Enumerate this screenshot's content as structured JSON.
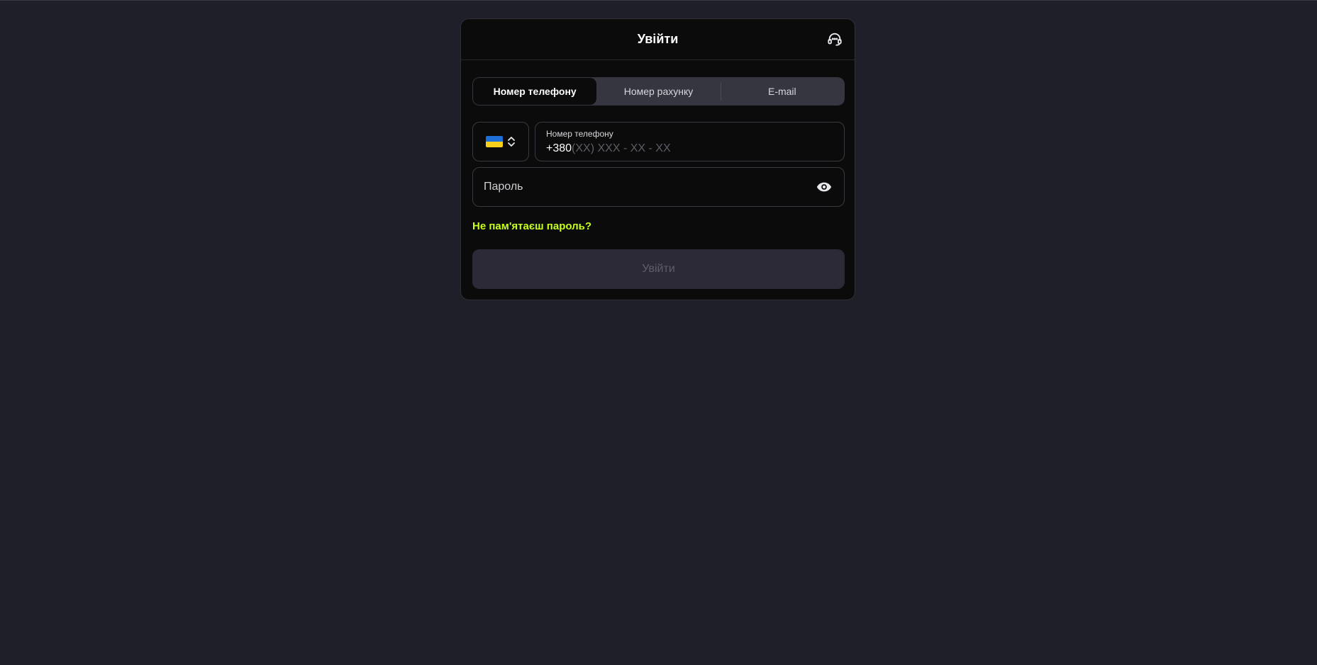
{
  "modal": {
    "title": "Увійти"
  },
  "tabs": [
    {
      "label": "Номер телефону",
      "active": true
    },
    {
      "label": "Номер рахунку",
      "active": false
    },
    {
      "label": "E-mail",
      "active": false
    }
  ],
  "country": {
    "selected": "ukraine-flag"
  },
  "phone": {
    "label": "Номер телефону",
    "prefix": "+380",
    "mask": "(XX) XXX - XX - XX"
  },
  "password": {
    "placeholder": "Пароль"
  },
  "forgot": {
    "label": "Не пам'ятаєш пароль?"
  },
  "submit": {
    "label": "Увійти"
  },
  "colors": {
    "background": "#1f1f29",
    "modal": "#0b0b0b",
    "accent": "#c6ff1a",
    "tab_bar": "#353640",
    "submit_disabled": "#2b2a36"
  },
  "icons": {
    "support": "headset-icon",
    "password_toggle": "eye-icon",
    "country_chevron": "chevron-up-down-icon"
  }
}
